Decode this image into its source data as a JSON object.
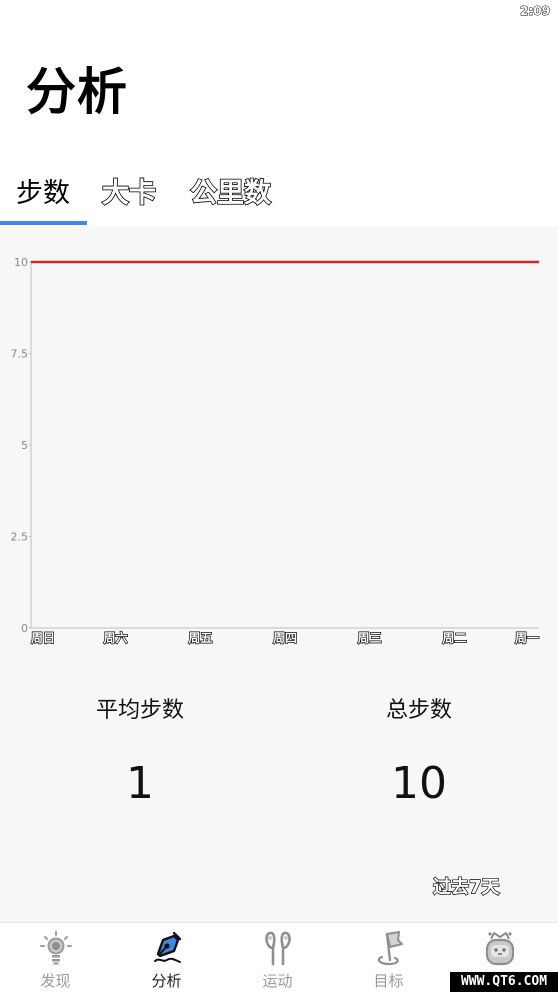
{
  "status_bar": {
    "time": "2:09"
  },
  "header": {
    "title": "分析"
  },
  "tabs": [
    {
      "label": "步数",
      "active": true
    },
    {
      "label": "大卡",
      "active": false
    },
    {
      "label": "公里数",
      "active": false
    }
  ],
  "colors": {
    "accent": "#3d8ae4",
    "series_line": "#d0262b",
    "axis": "#bfbfbf",
    "content_bg": "#f7f7f7"
  },
  "chart_data": {
    "type": "line",
    "title": "",
    "xlabel": "",
    "ylabel": "",
    "categories": [
      "周日",
      "周六",
      "周五",
      "周四",
      "周三",
      "周二",
      "周一"
    ],
    "yticks": [
      "0",
      "2.5",
      "5",
      "7.5",
      "10"
    ],
    "ylim": [
      0,
      10
    ],
    "grid": false,
    "series": [
      {
        "name": "步数",
        "values": [
          10,
          10,
          10,
          10,
          10,
          10,
          10
        ]
      }
    ]
  },
  "stats": {
    "average": {
      "label": "平均步数",
      "value": "1"
    },
    "total": {
      "label": "总步数",
      "value": "10"
    }
  },
  "range_selector": {
    "label": "过去7天"
  },
  "bottom_nav": [
    {
      "label": "发现",
      "icon": "lightbulb-icon",
      "active": false
    },
    {
      "label": "分析",
      "icon": "pen-nib-icon",
      "active": true
    },
    {
      "label": "运动",
      "icon": "earphones-icon",
      "active": false
    },
    {
      "label": "目标",
      "icon": "flag-icon",
      "active": false
    },
    {
      "label": "",
      "icon": "robot-icon",
      "active": false
    }
  ],
  "watermark": {
    "text": "WWW.QT6.COM"
  }
}
